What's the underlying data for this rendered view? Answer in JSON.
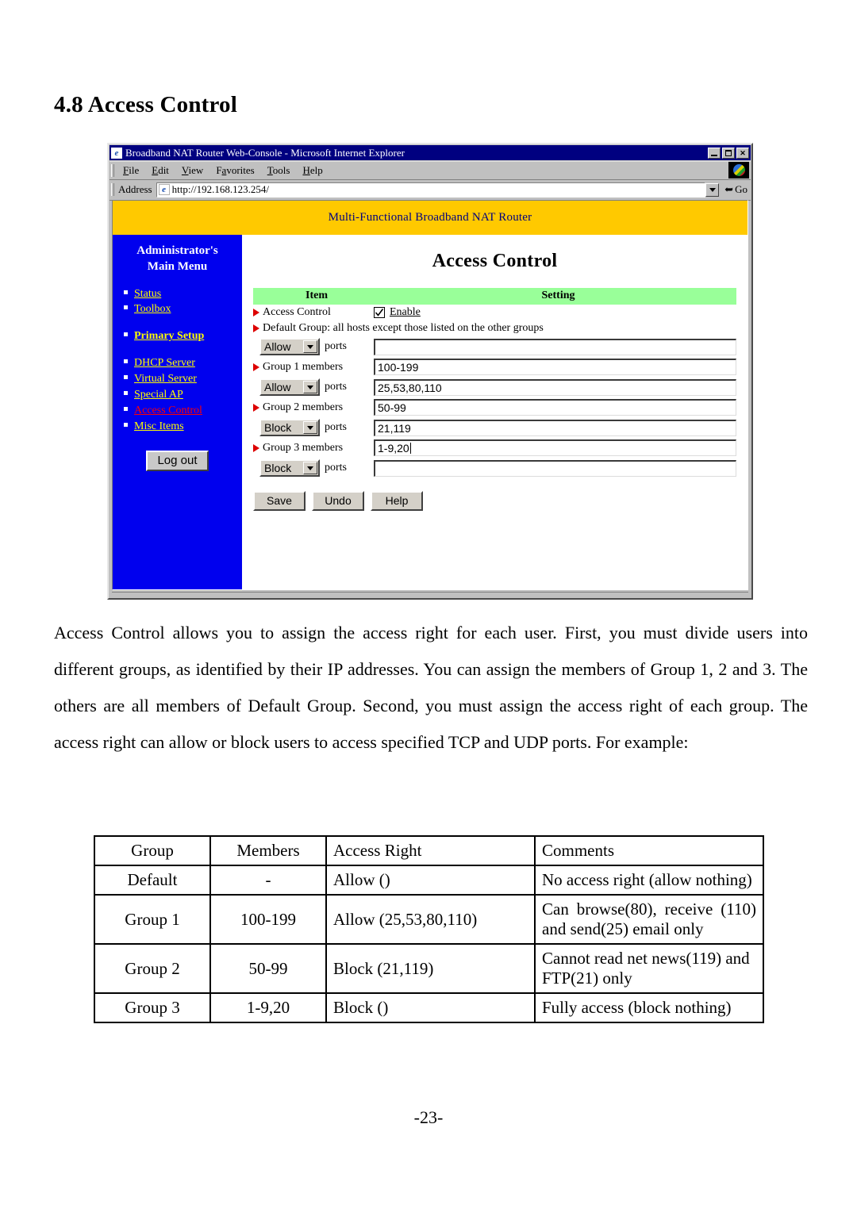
{
  "document": {
    "heading": "4.8 Access Control",
    "page_number": "-23-",
    "paragraph": "Access Control allows you to assign the access right for each user. First, you must divide users into different groups, as identified by their IP addresses. You can assign the members of Group 1, 2 and 3. The others are all members of Default Group. Second, you must assign the access right of each group. The access right can allow or block users to access specified TCP and UDP ports. For example:"
  },
  "browser": {
    "title": "Broadband NAT Router Web-Console - Microsoft Internet Explorer",
    "window_buttons": {
      "minimize": "_",
      "maximize": "□",
      "close": "✕"
    },
    "menu": [
      "File",
      "Edit",
      "View",
      "Favorites",
      "Tools",
      "Help"
    ],
    "address_label": "Address",
    "address_value": "http://192.168.123.254/",
    "go_label": "Go"
  },
  "router_ui": {
    "banner": "Multi-Functional Broadband NAT Router",
    "sidebar": {
      "title_line1": "Administrator's",
      "title_line2": "Main Menu",
      "groups": [
        {
          "items": [
            {
              "label": "Status",
              "style": "normal"
            },
            {
              "label": "Toolbox",
              "style": "normal"
            }
          ]
        },
        {
          "items": [
            {
              "label": "Primary Setup",
              "style": "bold"
            }
          ]
        },
        {
          "items": [
            {
              "label": "DHCP Server",
              "style": "normal"
            },
            {
              "label": "Virtual Server",
              "style": "normal"
            },
            {
              "label": "Special AP",
              "style": "normal"
            },
            {
              "label": "Access Control",
              "style": "active"
            },
            {
              "label": "Misc Items",
              "style": "normal"
            }
          ]
        }
      ],
      "logout_label": "Log out"
    },
    "page_title": "Access Control",
    "table_headers": {
      "item": "Item",
      "setting": "Setting"
    },
    "access_control_row": {
      "label": "Access Control",
      "checkbox_label": "Enable",
      "checkbox_checked": true
    },
    "default_group_note": "Default Group: all hosts except those listed on the other groups",
    "ports_label": "ports",
    "select_options": [
      "Allow",
      "Block"
    ],
    "rows": [
      {
        "type": "ports",
        "select": "Allow",
        "value": "",
        "caret": false
      },
      {
        "type": "members",
        "label": "Group 1 members",
        "value": "100-199",
        "caret": false
      },
      {
        "type": "ports",
        "select": "Allow",
        "value": "25,53,80,110",
        "caret": false
      },
      {
        "type": "members",
        "label": "Group 2 members",
        "value": "50-99",
        "caret": false
      },
      {
        "type": "ports",
        "select": "Block",
        "value": "21,119",
        "caret": false
      },
      {
        "type": "members",
        "label": "Group 3 members",
        "value": "1-9,20",
        "caret": true
      },
      {
        "type": "ports",
        "select": "Block",
        "value": "",
        "caret": false
      }
    ],
    "buttons": {
      "save": "Save",
      "undo": "Undo",
      "help": "Help"
    },
    "colors": {
      "banner_bg": "#ffc900",
      "banner_text": "#000080",
      "sidebar_bg": "#0000ee",
      "link": "#ffff00",
      "link_active": "#ff0000",
      "table_header_bg": "#99ff99",
      "arrow_marker": "#dd0000",
      "titlebar_bg": "#000080"
    }
  },
  "example_table": {
    "headers": [
      "Group",
      "Members",
      "Access Right",
      "Comments"
    ],
    "rows": [
      {
        "group": "Default",
        "members": "-",
        "right": "Allow ()",
        "comments": "No access right (allow nothing)"
      },
      {
        "group": "Group 1",
        "members": "100-199",
        "right": "Allow (25,53,80,110)",
        "comments": "Can browse(80), receive (110) and send(25) email only"
      },
      {
        "group": "Group 2",
        "members": "50-99",
        "right": "Block (21,119)",
        "comments": "Cannot read net news(119) and FTP(21) only"
      },
      {
        "group": "Group 3",
        "members": "1-9,20",
        "right": "Block ()",
        "comments": "Fully access (block nothing)"
      }
    ]
  }
}
